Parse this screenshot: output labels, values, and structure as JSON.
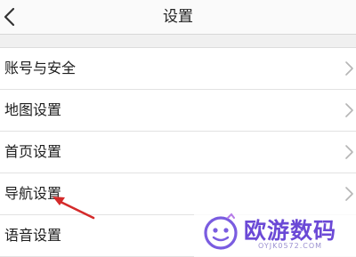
{
  "header": {
    "title": "设置",
    "back_icon": "chevron-left-icon"
  },
  "settings": {
    "items": [
      {
        "label": "账号与安全",
        "icon": "chevron-right-icon"
      },
      {
        "label": "地图设置",
        "icon": "chevron-right-icon"
      },
      {
        "label": "首页设置",
        "icon": "chevron-right-icon"
      },
      {
        "label": "导航设置",
        "icon": "chevron-right-icon"
      },
      {
        "label": "语音设置"
      }
    ]
  },
  "annotation": {
    "arrow_color": "#d42a2a",
    "points_to": "导航设置"
  },
  "watermark": {
    "brand": "欧游数码",
    "url": "OYJK0572.COM",
    "color": "#6b49d6"
  }
}
